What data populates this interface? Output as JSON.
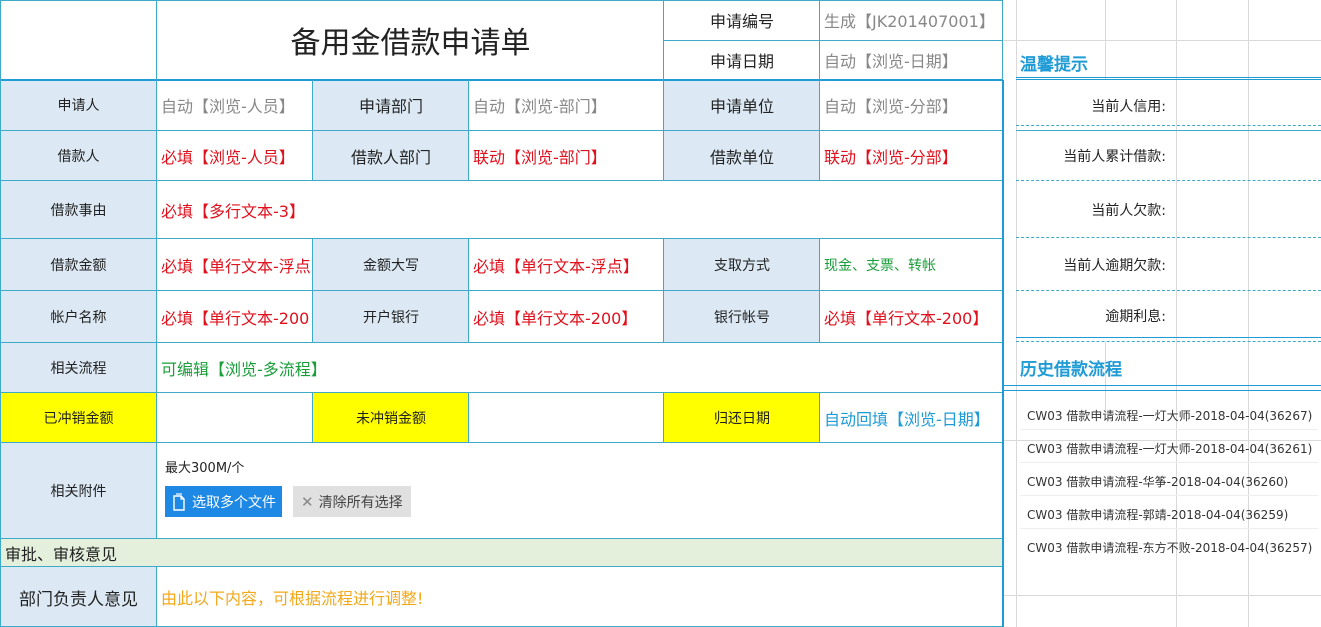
{
  "form": {
    "title": "备用金借款申请单",
    "apply_no_label": "申请编号",
    "apply_no_value": "生成【JK201407001】",
    "apply_date_label": "申请日期",
    "apply_date_value": "自动【浏览-日期】",
    "rows": {
      "applicant_label": "申请人",
      "applicant_value": "自动【浏览-人员】",
      "apply_dept_label": "申请部门",
      "apply_dept_value": "自动【浏览-部门】",
      "apply_unit_label": "申请单位",
      "apply_unit_value": "自动【浏览-分部】",
      "borrower_label": "借款人",
      "borrower_value": "必填【浏览-人员】",
      "borrower_dept_label": "借款人部门",
      "borrower_dept_value": "联动【浏览-部门】",
      "borrower_unit_label": "借款单位",
      "borrower_unit_value": "联动【浏览-分部】",
      "reason_label": "借款事由",
      "reason_value": "必填【多行文本-3】",
      "amount_label": "借款金额",
      "amount_value": "必填【单行文本-浮点",
      "amount_upper_label": "金额大写",
      "amount_upper_value": "必填【单行文本-浮点】",
      "pay_method_label": "支取方式",
      "pay_method_value": "现金、支票、转帐",
      "account_name_label": "帐户名称",
      "account_name_value": "必填【单行文本-200",
      "bank_label": "开户银行",
      "bank_value": "必填【单行文本-200】",
      "bank_account_label": "银行帐号",
      "bank_account_value": "必填【单行文本-200】",
      "related_flow_label": "相关流程",
      "related_flow_value": "可编辑【浏览-多流程】",
      "offset_label": "已冲销金额",
      "unoffset_label": "未冲销金额",
      "return_date_label": "归还日期",
      "return_date_value": "自动回填【浏览-日期】",
      "attachment_label": "相关附件",
      "attachment_limit": "最大300M/个",
      "select_files_btn": "选取多个文件",
      "clear_btn": "清除所有选择"
    },
    "approval_section": "审批、审核意见",
    "dept_opinion_label": "部门负责人意见",
    "dept_opinion_value": "由此以下内容，可根据流程进行调整!"
  },
  "sidebar": {
    "tips_title": "温馨提示",
    "credit_label": "当前人信用:",
    "total_borrow_label": "当前人累计借款:",
    "owe_label": "当前人欠款:",
    "overdue_label": "当前人逾期欠款:",
    "interest_label": "逾期利息:",
    "history_title": "历史借款流程",
    "history": [
      "CW03 借款申请流程-一灯大师-2018-04-04(36267)",
      "CW03 借款申请流程-一灯大师-2018-04-04(36261)",
      "CW03 借款申请流程-华筝-2018-04-04(36260)",
      "CW03 借款申请流程-郭靖-2018-04-04(36259)",
      "CW03 借款申请流程-东方不败-2018-04-04(36257)"
    ]
  },
  "colors": {
    "label_bg": "#dce9f4",
    "highlight_bg": "#ffff00",
    "border": "#3eaac9",
    "required_text": "#e0101c",
    "auto_text": "#888888",
    "editable_text": "#1a9e3a",
    "accent": "#1f9bd6",
    "button_primary": "#1e88e5"
  }
}
